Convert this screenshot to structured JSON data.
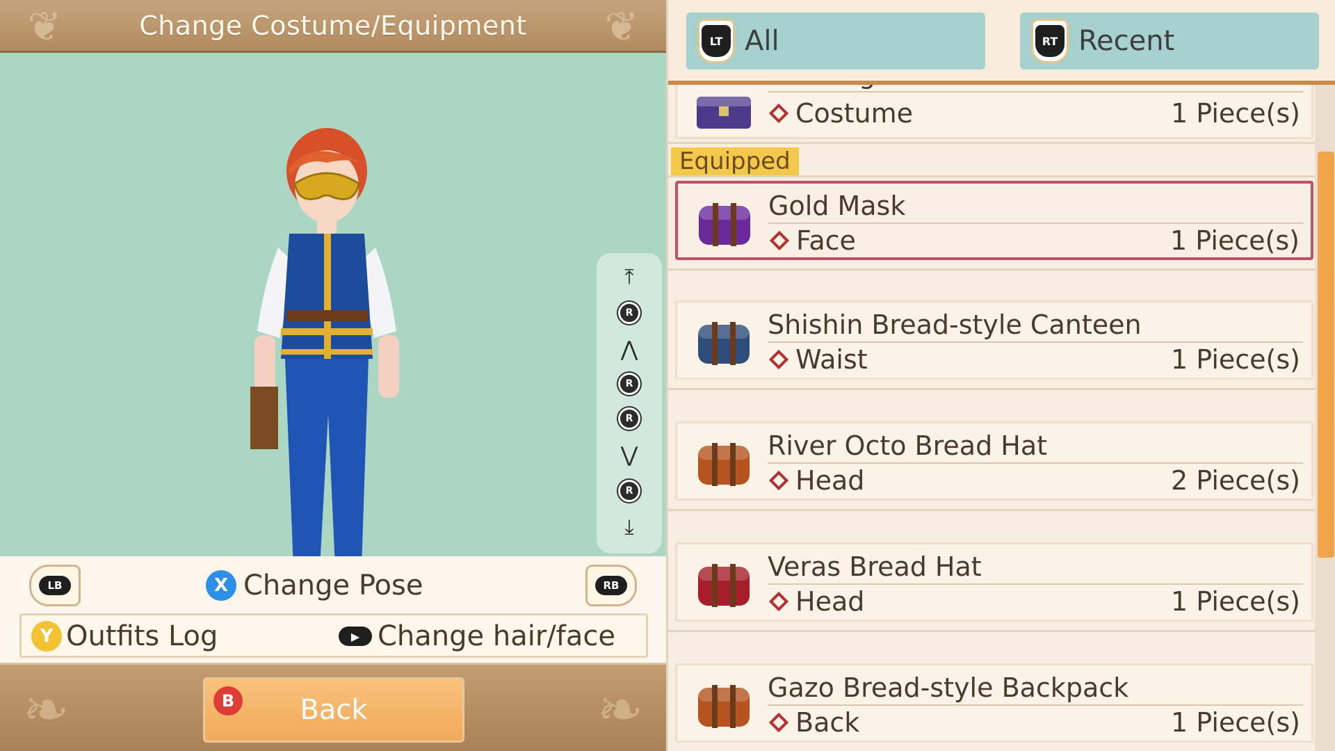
{
  "window": {
    "title": "Change Costume/Equipment"
  },
  "preview": {
    "character": "player-avatar",
    "camera_controls": [
      {
        "icon": "scroll-top-icon",
        "glyph": "⤒"
      },
      {
        "icon": "rstick-up-icon",
        "glyph": "R"
      },
      {
        "icon": "zoom-in-icon",
        "glyph": "⋀"
      },
      {
        "icon": "rstick-left-icon",
        "glyph": "R"
      },
      {
        "icon": "rstick-right-icon",
        "glyph": "R"
      },
      {
        "icon": "zoom-out-icon",
        "glyph": "⋁"
      },
      {
        "icon": "rstick-down-icon",
        "glyph": "R"
      },
      {
        "icon": "scroll-bottom-icon",
        "glyph": "⤓"
      }
    ]
  },
  "controls": {
    "lb": "LB",
    "rb": "RB",
    "x_button": "X",
    "change_pose": "Change Pose",
    "y_button": "Y",
    "outfits_log": "Outfits Log",
    "change_hair_face": "Change hair/face"
  },
  "footer": {
    "b_button": "B",
    "back_label": "Back"
  },
  "tabs": [
    {
      "shoulder": "LT",
      "label": "All"
    },
    {
      "shoulder": "RT",
      "label": "Recent"
    }
  ],
  "list": {
    "top_item": {
      "name": "Gold Light Armor",
      "slot": "Costume",
      "qty": "1 Piece(s)",
      "color": "#4b3a8c"
    },
    "equipped_label": "Equipped",
    "items": [
      {
        "name": "Gold Mask",
        "slot": "Face",
        "qty": "1 Piece(s)",
        "color": "#6a2a9c",
        "equipped": true
      },
      {
        "name": "Shishin Bread-style Canteen",
        "slot": "Waist",
        "qty": "1 Piece(s)",
        "color": "#2e4d7a"
      },
      {
        "name": "River Octo Bread Hat",
        "slot": "Head",
        "qty": "2 Piece(s)",
        "color": "#b5541e"
      },
      {
        "name": "Veras Bread Hat",
        "slot": "Head",
        "qty": "1 Piece(s)",
        "color": "#a51e2a"
      },
      {
        "name": "Gazo Bread-style Backpack",
        "slot": "Back",
        "qty": "1 Piece(s)",
        "color": "#b5541e"
      }
    ]
  },
  "colors": {
    "accent": "#f2a44a",
    "preview_bg": "#acd6c4",
    "tab_bg": "#a6d1ce",
    "equipped_border": "#c0506a"
  }
}
